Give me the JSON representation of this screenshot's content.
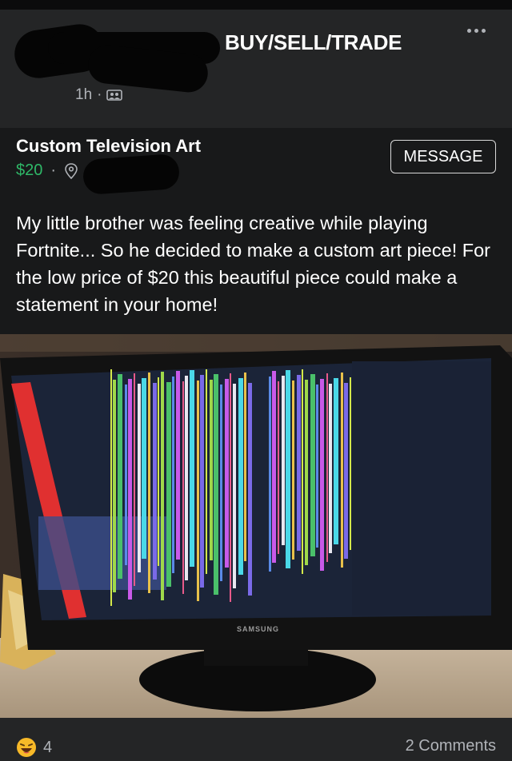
{
  "post": {
    "group": "BUY/SELL/TRADE",
    "time": "1h",
    "meta_separator": "·",
    "title": "Custom Television Art",
    "price": "$20",
    "price_separator": "·",
    "message_button": "MESSAGE",
    "body": "My little brother was feeling creative while playing Fortnite... So he decided to make a custom art piece! For the low price of $20 this beautiful piece could make a statement in your home!"
  },
  "photo": {
    "brand": "SAMSUNG"
  },
  "footer": {
    "reaction_count": "4",
    "comments": "2 Comments"
  },
  "icons": {
    "more": "more-options-icon",
    "audience": "group-audience-icon",
    "location": "location-pin-icon",
    "reaction": "laughing-emoji-icon"
  },
  "colors": {
    "background": "#18191a",
    "price": "#2fb868"
  }
}
